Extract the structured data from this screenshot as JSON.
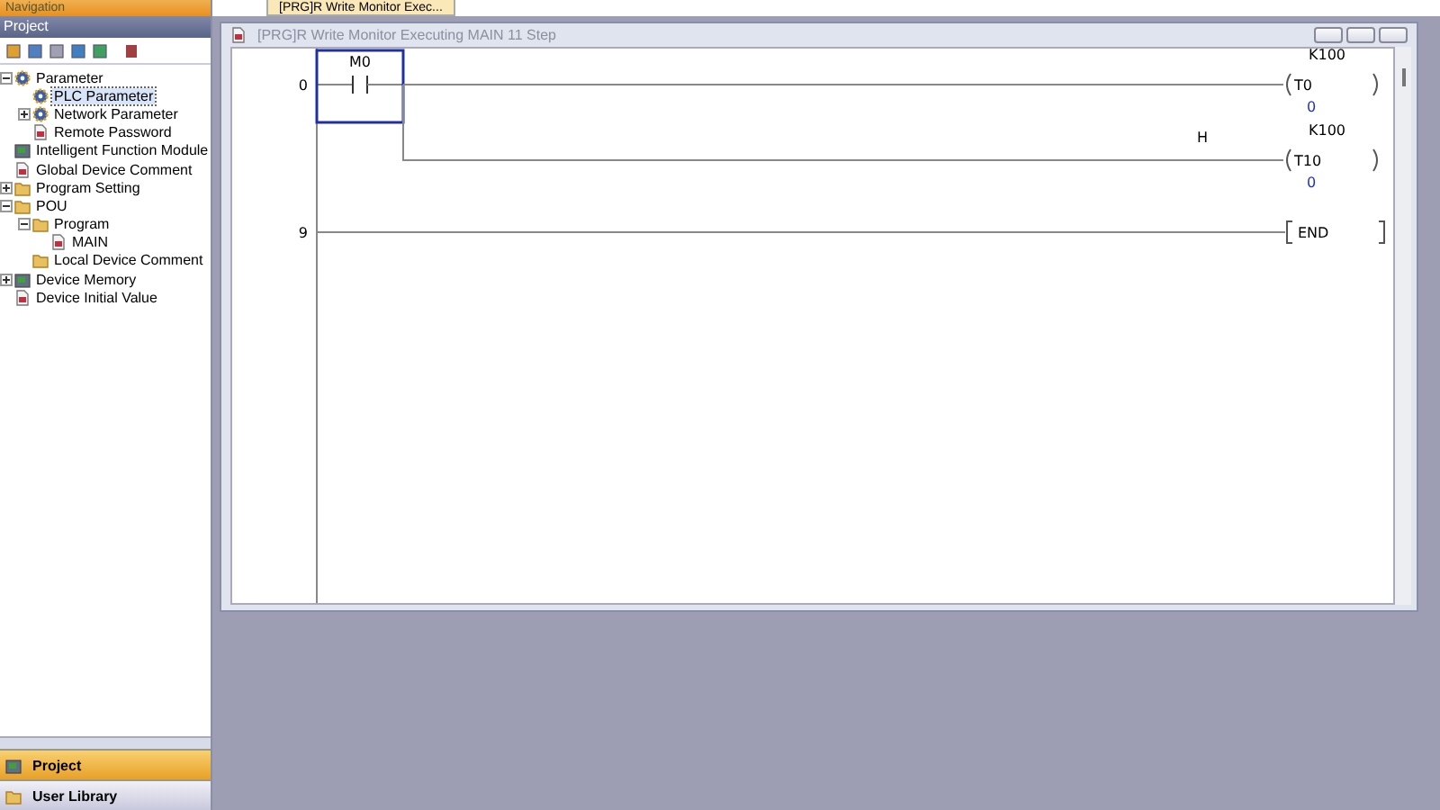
{
  "navigation": {
    "title": "Navigation",
    "pane_title": "Project"
  },
  "tree": [
    {
      "label": "Parameter",
      "kind": "gear",
      "expanded": true,
      "selected": false,
      "children": [
        {
          "label": "PLC Parameter",
          "kind": "gear",
          "selected": true
        },
        {
          "label": "Network Parameter",
          "kind": "gear",
          "expanded": false,
          "selected": false
        },
        {
          "label": "Remote Password",
          "kind": "document",
          "selected": false
        }
      ]
    },
    {
      "label": "Intelligent Function Module",
      "kind": "device",
      "selected": false
    },
    {
      "label": "Global Device Comment",
      "kind": "document",
      "selected": false
    },
    {
      "label": "Program Setting",
      "kind": "folder",
      "expanded": false,
      "selected": false
    },
    {
      "label": "POU",
      "kind": "folder",
      "expanded": true,
      "selected": false,
      "children": [
        {
          "label": "Program",
          "kind": "folder",
          "expanded": true,
          "selected": false,
          "children": [
            {
              "label": "MAIN",
              "kind": "document",
              "selected": false
            }
          ]
        },
        {
          "label": "Local Device Comment",
          "kind": "folder",
          "selected": false
        }
      ]
    },
    {
      "label": "Device Memory",
      "kind": "device",
      "expanded": false,
      "selected": false
    },
    {
      "label": "Device Initial Value",
      "kind": "document",
      "selected": false
    }
  ],
  "bottom_tabs": [
    {
      "label": "Project",
      "selected": true
    },
    {
      "label": "User Library",
      "selected": false
    }
  ],
  "document_tabs": [
    {
      "label": "[PRG]R Write Monitor Exec...",
      "selected": true
    }
  ],
  "window": {
    "title": "[PRG]R Write Monitor Executing MAIN 11 Step"
  },
  "ladder": {
    "rungs": [
      {
        "step": "0",
        "contact": {
          "device": "M0",
          "selected": true
        },
        "coils": [
          {
            "device": "T0",
            "setting": "K100",
            "value": "0"
          },
          {
            "device": "T10",
            "prefix": "H",
            "setting": "K100",
            "value": "0"
          }
        ]
      },
      {
        "step": "9",
        "end": "END"
      }
    ]
  }
}
